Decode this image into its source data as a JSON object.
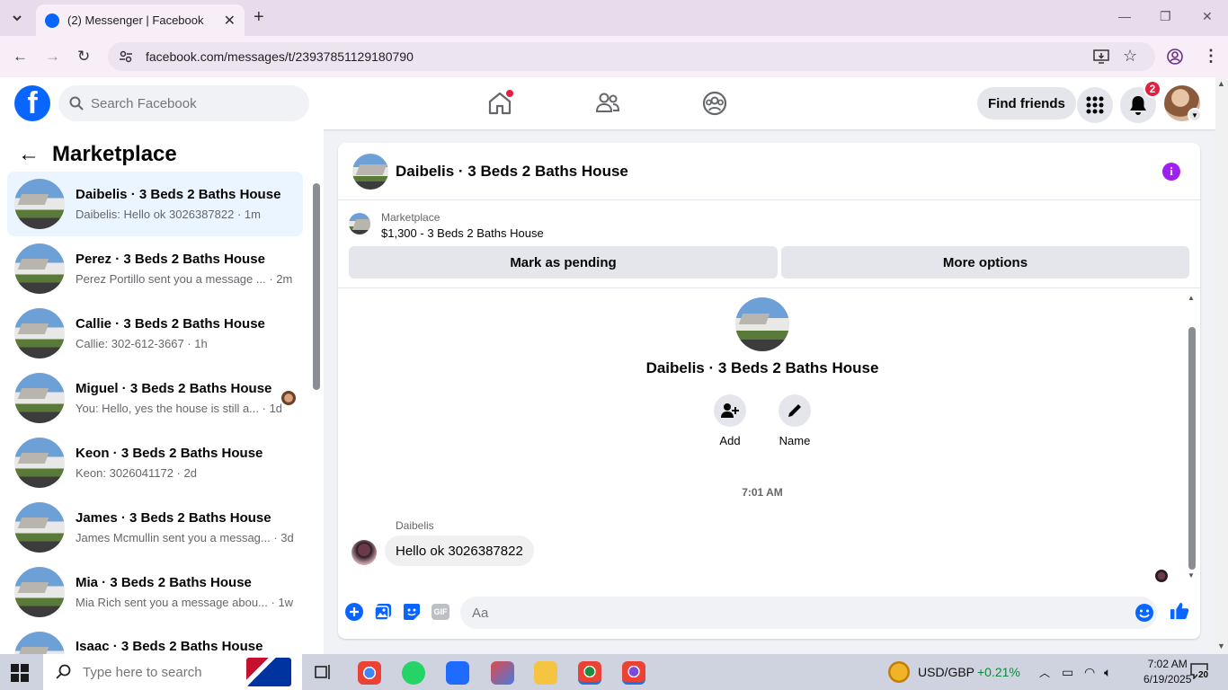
{
  "browser": {
    "tab_title": "(2) Messenger | Facebook",
    "url": "facebook.com/messages/t/23937851129180790"
  },
  "fb_header": {
    "search_placeholder": "Search Facebook",
    "find_friends": "Find friends",
    "notification_count": "2"
  },
  "sidebar": {
    "title": "Marketplace",
    "conversations": [
      {
        "name": "Daibelis · 3 Beds 2 Baths House",
        "preview": "Daibelis: Hello ok 3026387822 · 1m"
      },
      {
        "name": "Perez · 3 Beds 2 Baths House",
        "preview": "Perez Portillo sent you a message ... · 2m"
      },
      {
        "name": "Callie · 3 Beds 2 Baths House",
        "preview": "Callie: 302-612-3667 · 1h"
      },
      {
        "name": "Miguel · 3 Beds 2 Baths House",
        "preview": "You: Hello, yes the house is still a... · 1d"
      },
      {
        "name": "Keon · 3 Beds 2 Baths House",
        "preview": "Keon: 3026041172 · 2d"
      },
      {
        "name": "James · 3 Beds 2 Baths House",
        "preview": "James Mcmullin sent you a messag... · 3d"
      },
      {
        "name": "Mia · 3 Beds 2 Baths House",
        "preview": "Mia Rich sent you a message abou... · 1w"
      },
      {
        "name": "Isaac · 3 Beds 2 Baths House",
        "preview": ""
      }
    ]
  },
  "chat": {
    "title": "Daibelis · 3 Beds 2 Baths House",
    "marketplace_label": "Marketplace",
    "listing": "$1,300 - 3 Beds 2 Baths House",
    "mark_pending": "Mark as pending",
    "more_options": "More options",
    "profile_name": "Daibelis · 3 Beds 2 Baths House",
    "add_label": "Add",
    "name_label": "Name",
    "timestamp": "7:01 AM",
    "sender": "Daibelis",
    "message": "Hello ok 3026387822",
    "composer_placeholder": "Aa",
    "gif_label": "GIF"
  },
  "taskbar": {
    "search_placeholder": "Type here to search",
    "ticker": "USD/GBP",
    "ticker_change": "+0.21%",
    "time": "7:02 AM",
    "date": "6/19/2025",
    "notifications": "20"
  },
  "colors": {
    "fb_blue": "#0866ff",
    "active_row": "#ebf5ff",
    "badge_red": "#e41e3f",
    "info_purple": "#a020f0",
    "ticker_green": "#0a8a3a"
  }
}
